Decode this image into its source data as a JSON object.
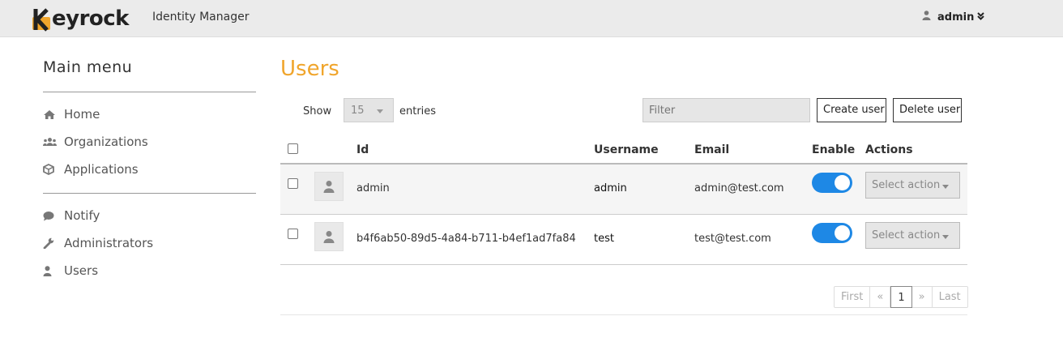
{
  "header": {
    "logo_text": "eyrock",
    "logo_letter": "K",
    "subtitle": "Identity Manager",
    "user_name": "admin",
    "user_icon": "user-icon",
    "chevron_icon": "double-chevron-down-icon"
  },
  "colors": {
    "accent": "#f0a52c",
    "toggle_on": "#1e88e5",
    "topbar": "#ebebeb"
  },
  "sidebar": {
    "title": "Main menu",
    "groups": [
      [
        {
          "label": "Home",
          "icon": "home-icon"
        },
        {
          "label": "Organizations",
          "icon": "users-icon"
        },
        {
          "label": "Applications",
          "icon": "cube-icon"
        }
      ],
      [
        {
          "label": "Notify",
          "icon": "chat-bubble-icon"
        },
        {
          "label": "Administrators",
          "icon": "wrench-icon"
        },
        {
          "label": "Users",
          "icon": "user-icon"
        }
      ]
    ]
  },
  "main": {
    "title": "Users",
    "show_label": "Show",
    "entries_value": "15",
    "entries_label": "entries",
    "filter_placeholder": "Filter",
    "create_user_label": "Create user",
    "delete_user_label": "Delete user"
  },
  "table": {
    "columns": [
      "Id",
      "Username",
      "Email",
      "Enable",
      "Actions"
    ],
    "rows": [
      {
        "id": "admin",
        "username": "admin",
        "email": "admin@test.com",
        "enabled": true,
        "action": "Select action"
      },
      {
        "id": "b4f6ab50-89d5-4a84-b711-b4ef1ad7fa84",
        "username": "test",
        "email": "test@test.com",
        "enabled": true,
        "action": "Select action"
      }
    ]
  },
  "pagination": {
    "first": "First",
    "prev": "«",
    "current": "1",
    "next": "»",
    "last": "Last"
  }
}
